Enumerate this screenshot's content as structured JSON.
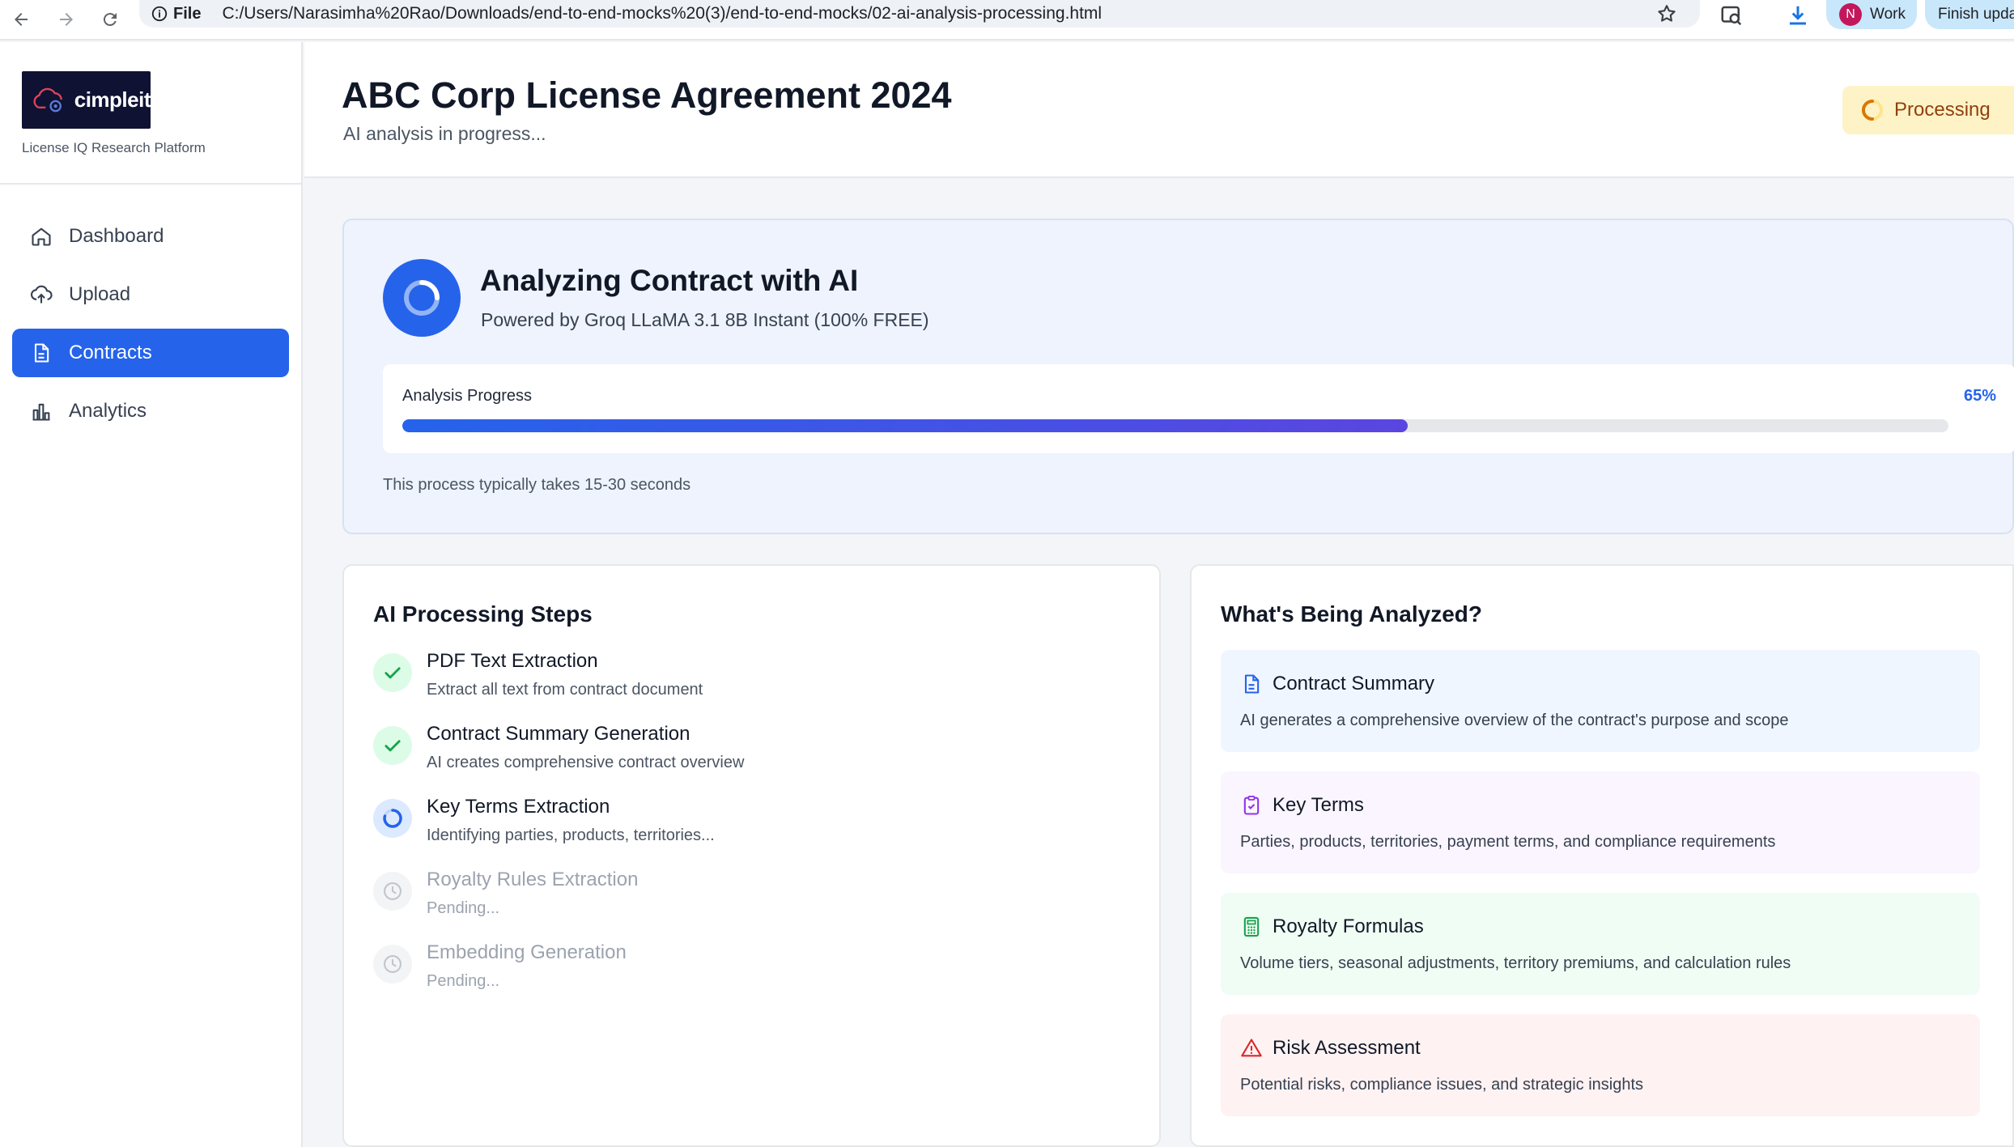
{
  "browser": {
    "file_label": "File",
    "url": "C:/Users/Narasimha%20Rao/Downloads/end-to-end-mocks%20(3)/end-to-end-mocks/02-ai-analysis-processing.html",
    "profile_initial": "N",
    "profile_name": "Work",
    "update_label": "Finish update"
  },
  "sidebar": {
    "logo_text": "cimpleit",
    "brand_subtitle": "License IQ Research Platform",
    "items": [
      {
        "label": "Dashboard",
        "icon": "home-icon",
        "active": false
      },
      {
        "label": "Upload",
        "icon": "upload-icon",
        "active": false
      },
      {
        "label": "Contracts",
        "icon": "document-icon",
        "active": true
      },
      {
        "label": "Analytics",
        "icon": "bar-chart-icon",
        "active": false
      }
    ]
  },
  "header": {
    "title": "ABC Corp License Agreement 2024",
    "subtitle": "AI analysis in progress...",
    "status": "Processing"
  },
  "analysis": {
    "title": "Analyzing Contract with AI",
    "subtitle": "Powered by Groq LLaMA 3.1 8B Instant (100% FREE)",
    "progress_label": "Analysis Progress",
    "progress_percent": 65,
    "progress_text": "65%",
    "note": "This process typically takes 15-30 seconds"
  },
  "steps": {
    "title": "AI Processing Steps",
    "items": [
      {
        "title": "PDF Text Extraction",
        "desc": "Extract all text from contract document",
        "state": "done"
      },
      {
        "title": "Contract Summary Generation",
        "desc": "AI creates comprehensive contract overview",
        "state": "done"
      },
      {
        "title": "Key Terms Extraction",
        "desc": "Identifying parties, products, territories...",
        "state": "active"
      },
      {
        "title": "Royalty Rules Extraction",
        "desc": "Pending...",
        "state": "pending"
      },
      {
        "title": "Embedding Generation",
        "desc": "Pending...",
        "state": "pending"
      }
    ]
  },
  "analyzed": {
    "title": "What's Being Analyzed?",
    "items": [
      {
        "title": "Contract Summary",
        "desc": "AI generates a comprehensive overview of the contract's purpose and scope",
        "icon": "document-icon",
        "bg": "#eff6ff",
        "accent": "#2563eb"
      },
      {
        "title": "Key Terms",
        "desc": "Parties, products, territories, payment terms, and compliance requirements",
        "icon": "clipboard-check-icon",
        "bg": "#faf5ff",
        "accent": "#9333ea"
      },
      {
        "title": "Royalty Formulas",
        "desc": "Volume tiers, seasonal adjustments, territory premiums, and calculation rules",
        "icon": "calculator-icon",
        "bg": "#f0fdf4",
        "accent": "#16a34a"
      },
      {
        "title": "Risk Assessment",
        "desc": "Potential risks, compliance issues, and strategic insights",
        "icon": "warning-icon",
        "bg": "#fef2f2",
        "accent": "#dc2626"
      }
    ]
  },
  "colors": {
    "primary": "#2563eb",
    "processing_bg": "#fef3c7",
    "processing_text": "#92400e",
    "success": "#16a34a"
  }
}
